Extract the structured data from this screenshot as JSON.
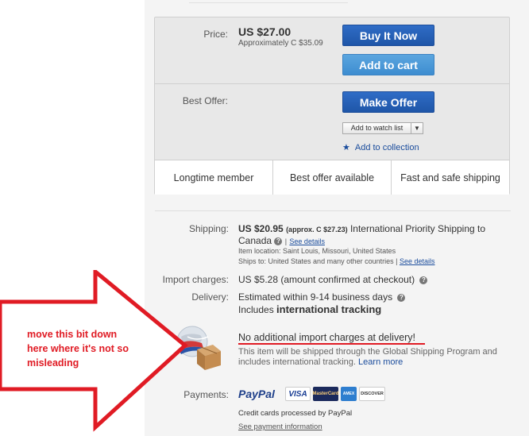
{
  "buybox": {
    "price_label": "Price:",
    "price": "US $27.00",
    "price_approx": "Approximately C $35.09",
    "buy_now": "Buy It Now",
    "add_to_cart": "Add to cart",
    "best_offer_label": "Best Offer:",
    "make_offer": "Make Offer",
    "watch_list": "Add to watch list",
    "add_collection": "Add to collection",
    "features": [
      "Longtime member",
      "Best offer available",
      "Fast and safe shipping"
    ]
  },
  "shipping": {
    "label": "Shipping:",
    "cost": "US $20.95",
    "approx": "(approx. C $27.23)",
    "service": "International Priority Shipping to",
    "dest": "Canada",
    "see_details": "See details",
    "location": "Item location:  Saint Louis, Missouri, United States",
    "ships_to": "Ships to:  United States and many other countries |",
    "see_details2": "See details"
  },
  "import": {
    "label": "Import charges:",
    "value": "US $5.28 (amount confirmed at checkout)"
  },
  "delivery": {
    "label": "Delivery:",
    "line1": "Estimated within 9-14 business days",
    "line2_prefix": "Includes",
    "line2_bold": "international tracking"
  },
  "gsp": {
    "headline": "No additional import charges at delivery!",
    "body1": "This item will be shipped through the Global Shipping Program and",
    "body2": "includes international tracking.",
    "learn_more": "Learn more"
  },
  "payments": {
    "label": "Payments:",
    "paypal": "PayPal",
    "visa": "VISA",
    "mastercard": "MasterCard",
    "amex": "AMEX",
    "discover": "DISCOVER",
    "credit_note": "Credit cards processed by PayPal",
    "see_info": "See payment information"
  },
  "annotation": {
    "line1": "move this bit down",
    "line2": "here where it's not so",
    "line3": "misleading"
  },
  "colors": {
    "annotation_red": "#e01b24",
    "button_blue": "#1f56a8",
    "link_blue": "#1a4c9c"
  }
}
